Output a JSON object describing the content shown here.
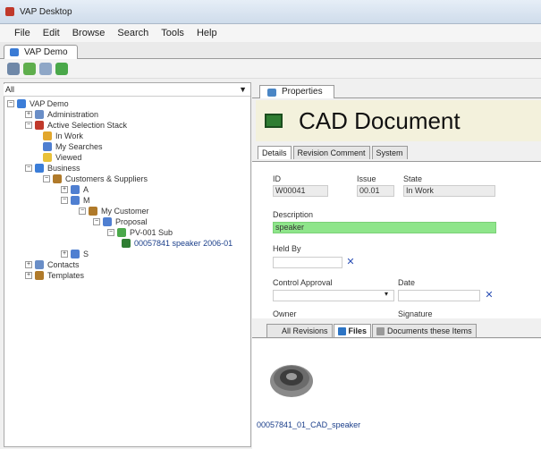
{
  "window": {
    "title": "VAP Desktop"
  },
  "menu": [
    "File",
    "Edit",
    "Browse",
    "Search",
    "Tools",
    "Help"
  ],
  "doc_tab": {
    "label": "VAP Demo"
  },
  "toolbar_icons": [
    "save-icon",
    "add-icon",
    "settings-icon",
    "refresh-icon"
  ],
  "combo": {
    "value": "All"
  },
  "tree": [
    {
      "label": "VAP Demo",
      "level": 0,
      "icon": "#3b7dd8"
    },
    {
      "label": "Administration",
      "level": 1,
      "icon": "#6a8ec7"
    },
    {
      "label": "Active Selection Stack",
      "level": 1,
      "icon": "#c0392b"
    },
    {
      "label": "In Work",
      "level": 2,
      "icon": "#e2a72e"
    },
    {
      "label": "My Searches",
      "level": 2,
      "icon": "#4f7fd1"
    },
    {
      "label": "Viewed",
      "level": 2,
      "icon": "#e8c13a"
    },
    {
      "label": "Business",
      "level": 1,
      "icon": "#3b7dd8"
    },
    {
      "label": "Customers & Suppliers",
      "level": 2,
      "icon": "#b07a2a"
    },
    {
      "label": "A",
      "level": 3,
      "icon": "#4f7fd1"
    },
    {
      "label": "M",
      "level": 3,
      "icon": "#4f7fd1"
    },
    {
      "label": "My Customer",
      "level": 4,
      "icon": "#b07a2a"
    },
    {
      "label": "Proposal",
      "level": 5,
      "icon": "#4f7fd1"
    },
    {
      "label": "PV-001 Sub",
      "level": 6,
      "icon": "#4aa84a"
    },
    {
      "label": "00057841 speaker 2006-01",
      "level": 7,
      "icon": "#2f7d32"
    },
    {
      "label": "S",
      "level": 3,
      "icon": "#4f7fd1"
    },
    {
      "label": "Contacts",
      "level": 1,
      "icon": "#6a8ec7"
    },
    {
      "label": "Templates",
      "level": 1,
      "icon": "#b07a2a"
    }
  ],
  "props_tab": {
    "label": "Properties"
  },
  "header": {
    "title": "CAD Document"
  },
  "subtabs": [
    "Details",
    "Revision Comment",
    "System"
  ],
  "form": {
    "id_label": "ID",
    "id_value": "W00041",
    "issue_label": "Issue",
    "issue_value": "00.01",
    "state_label": "State",
    "state_value": "In Work",
    "description_label": "Description",
    "description_value": "speaker",
    "held_by_label": "Held By",
    "held_by_value": "",
    "controlled_approval_label": "Control Approval",
    "controlled_approval_value": "",
    "date_label": "Date",
    "date_value": "",
    "owner_label": "Owner",
    "signature_label": "Signature"
  },
  "bottom_tabs": [
    "All Revisions",
    "Files",
    "Documents these Items"
  ],
  "files": {
    "filename": "00057841_01_CAD_speaker"
  },
  "colors": {
    "accent": "#3b7dd8",
    "description_highlight": "#8ee58a",
    "header_band": "#f3f1dc"
  }
}
